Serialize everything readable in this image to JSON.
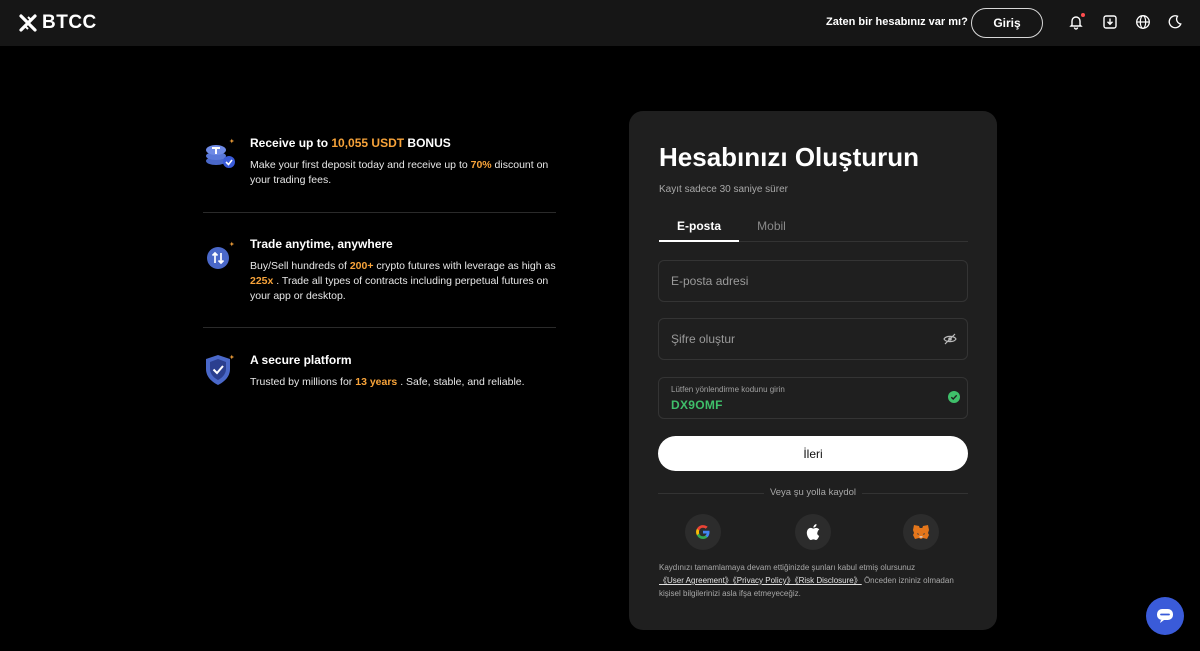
{
  "header": {
    "logo_text": "BTCC",
    "have_account": "Zaten bir hesabınız var mı?",
    "login_label": "Giriş",
    "icons": [
      "bell-icon",
      "download-icon",
      "globe-icon",
      "moon-icon"
    ]
  },
  "features": [
    {
      "title_prefix": "Receive up to ",
      "title_highlight": "10,055 USDT",
      "title_suffix": " BONUS",
      "desc_prefix": "Make your first deposit today and receive up to ",
      "desc_highlight": "70%",
      "desc_suffix": " discount on your trading fees."
    },
    {
      "title": "Trade anytime, anywhere",
      "desc_a": "Buy/Sell hundreds of ",
      "desc_hl1": "200+",
      "desc_b": " crypto futures with leverage as high as ",
      "desc_hl2": "225x",
      "desc_c": " . Trade all types of contracts including perpetual futures on your app or desktop."
    },
    {
      "title": "A secure platform",
      "desc_prefix": "Trusted by millions for ",
      "desc_highlight": "13 years",
      "desc_suffix": " . Safe, stable, and reliable."
    }
  ],
  "card": {
    "title": "Hesabınızı Oluşturun",
    "subtitle": "Kayıt sadece 30 saniye sürer",
    "tabs": [
      {
        "label": "E-posta",
        "active": true
      },
      {
        "label": "Mobil",
        "active": false
      }
    ],
    "email_placeholder": "E-posta adresi",
    "password_placeholder": "Şifre oluştur",
    "referral_label": "Lütfen yönlendirme kodunu girin",
    "referral_value": "DX9OMF",
    "next_label": "İleri",
    "or_text": "Veya şu yolla kaydol",
    "social": [
      "google-icon",
      "apple-icon",
      "metamask-icon"
    ],
    "terms_prefix": "Kaydınızı tamamlamaya devam ettiğinizde şunları kabul etmiş olursunuz",
    "terms_link": "《User Agreement》《Privacy Policy》《Risk Disclosure》",
    "terms_suffix": " Önceden izniniz olmadan kişisel bilgilerinizi asla ifşa etmeyeceğiz."
  },
  "colors": {
    "highlight": "#f7a33a",
    "referral_green": "#3fbf6a",
    "chat_blue": "#3a5bd9"
  }
}
